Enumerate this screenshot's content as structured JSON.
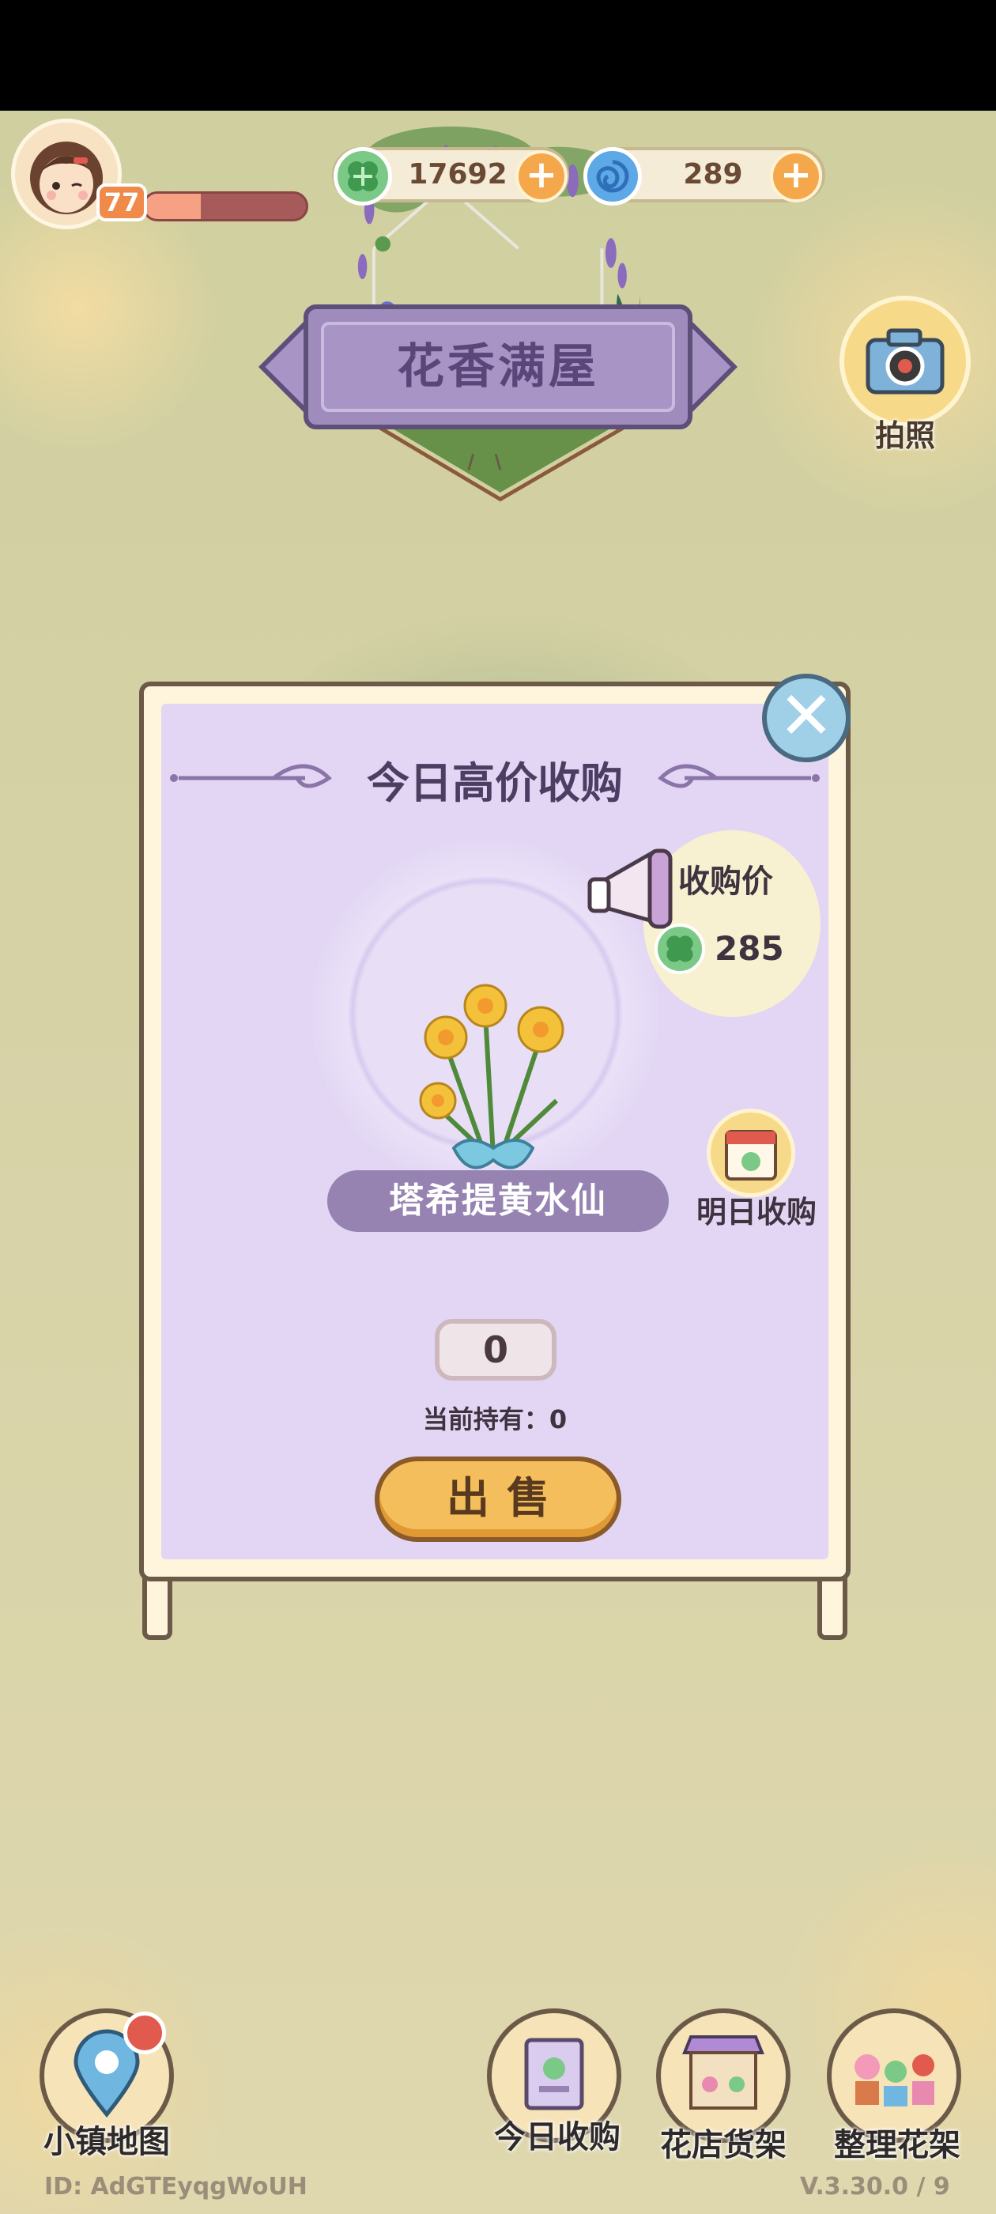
{
  "player": {
    "level": "77",
    "xp_fraction": 0.35
  },
  "currencies": {
    "clover": {
      "value": "17692",
      "icon": "clover-coin-icon",
      "color": "#7bc986"
    },
    "swirl": {
      "value": "289",
      "icon": "blue-swirl-gem-icon",
      "color": "#5da8e6"
    },
    "plus_label": "+"
  },
  "location_title": "花香满屋",
  "camera": {
    "label": "拍照",
    "icon": "camera-icon"
  },
  "dialog": {
    "title": "今日高价收购",
    "close_label": "✕",
    "price_label": "收购价",
    "price_value": "285",
    "flower_name": "塔希提黄水仙",
    "tomorrow_label": "明日收购",
    "quantity": "0",
    "holding_text": "当前持有：0",
    "sell_label": "出售"
  },
  "nav": {
    "map_label": "小镇地图",
    "today_label": "今日收购",
    "shelf_label": "花店货架",
    "arrange_label": "整理花架"
  },
  "footer": {
    "id_text": "ID:  AdGTEyqgWoUH",
    "version": "V.3.30.0 / 9"
  },
  "colors": {
    "accent_purple": "#9683b2",
    "panel_lavender": "#e3d6f4",
    "sell_button": "#f5be5c",
    "notification_red": "#e05a4e"
  }
}
